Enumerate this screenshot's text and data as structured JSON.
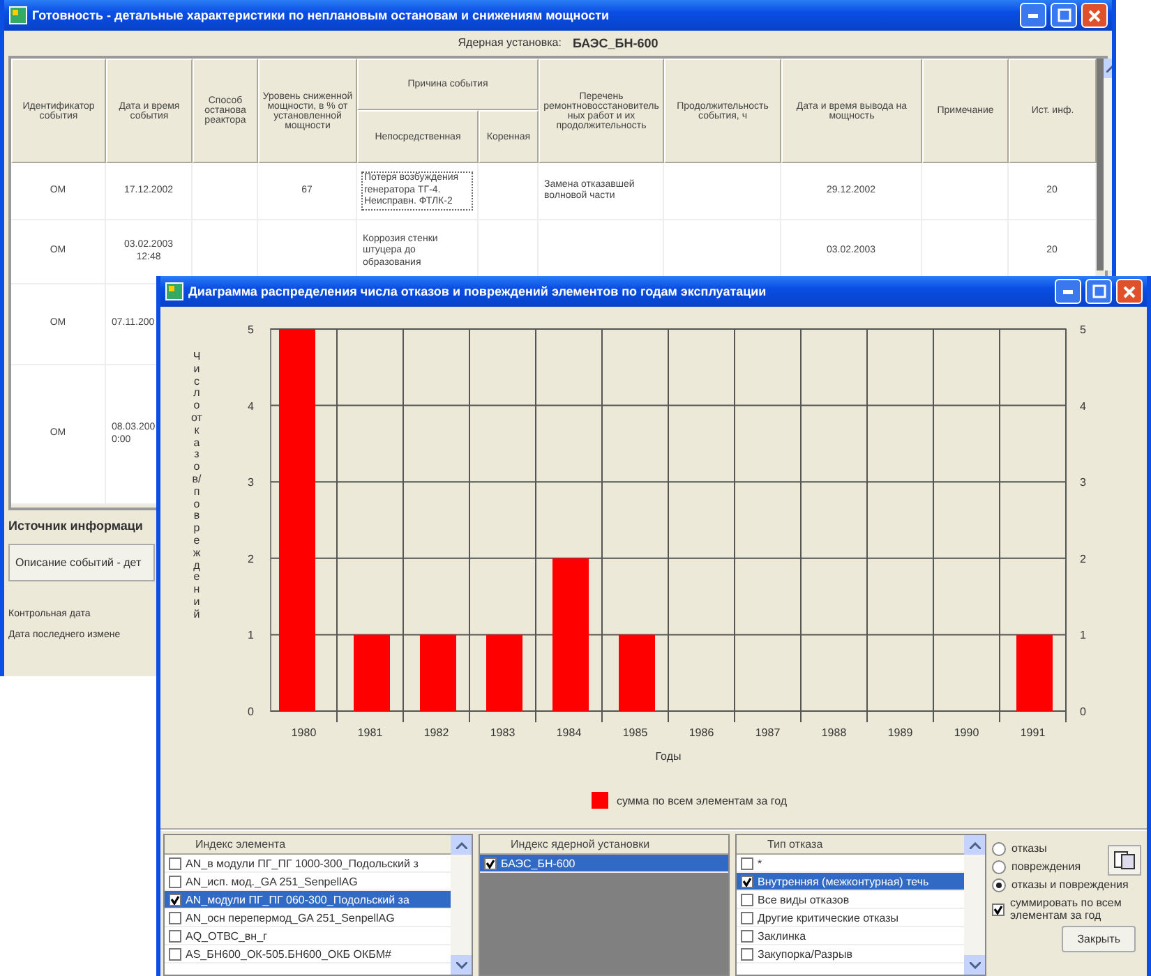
{
  "main_window": {
    "title": "Готовность - детальные характеристики по неплановым остановам и снижениям мощности",
    "plant_label": "Ядерная установка:",
    "plant_value": "БАЭС_БН-600",
    "columns": [
      {
        "label": "Идентификатор события"
      },
      {
        "label": "Дата и время события"
      },
      {
        "label": "Способ останова реактора"
      },
      {
        "label": "Уровень сниженной мощности, в % от установленной мощности"
      },
      {
        "label": "Причина события",
        "children": [
          {
            "label": "Непосредственная"
          },
          {
            "label": "Коренная"
          }
        ]
      },
      {
        "label": "Перечень ремонтновосстановительных работ и их продолжительность"
      },
      {
        "label": "Продолжительность события, ч"
      },
      {
        "label": "Дата и время вывода на мощность"
      },
      {
        "label": "Примечание"
      },
      {
        "label": "Ист. инф."
      }
    ],
    "rows": [
      {
        "id": "ОМ",
        "date": "17.12.2002",
        "power_level": "67",
        "cause_direct": "Потеря возбуждения генератора ТГ-4. Неисправн. ФТЛК-2",
        "repairs": "Замена отказавшей волновой части",
        "return_date": "29.12.2002",
        "source": "20"
      },
      {
        "id": "ОМ",
        "date": "03.02.2003 12:48",
        "cause_direct": "Коррозия стенки штуцера до образования",
        "return_date": "03.02.2003",
        "source": "20"
      },
      {
        "id": "ОМ",
        "date": "07.11.200"
      },
      {
        "id": "ОМ",
        "date": "08.03.200 0:00"
      }
    ],
    "source_heading": "Источник информаци",
    "description_button": "Описание событий - дет",
    "control_date_label": "Контрольная дата",
    "last_change_label": "Дата последнего измене"
  },
  "chart_window": {
    "title": "Диаграмма распределения числа отказов и повреждений элементов по годам эксплуатации",
    "chart_data": {
      "type": "bar",
      "xlabel": "Годы",
      "ylabel": "Число отказов/повреждений",
      "categories": [
        "1980",
        "1981",
        "1982",
        "1983",
        "1984",
        "1985",
        "1986",
        "1987",
        "1988",
        "1989",
        "1990",
        "1991"
      ],
      "series": [
        {
          "name": "сумма по всем элементам за год",
          "color": "#ff0000",
          "values": [
            5,
            1,
            1,
            1,
            2,
            1,
            0,
            0,
            0,
            0,
            0,
            1
          ]
        }
      ],
      "ylim": [
        0,
        5
      ],
      "yticks": [
        {
          "value": 0,
          "label": "0"
        },
        {
          "value": 1,
          "label": "1"
        },
        {
          "value": 2,
          "label": "2"
        },
        {
          "value": 3,
          "label": "3"
        },
        {
          "value": 4,
          "label": "4"
        },
        {
          "value": 5,
          "label": "5"
        }
      ],
      "grid": true
    },
    "right_axis_ticks": [
      "5",
      "4",
      "3",
      "2",
      "1",
      "0"
    ],
    "element_list": {
      "header": "Индекс элемента",
      "items": [
        {
          "label": "AN_в модули ПГ_ПГ 1000-300_Подольский з",
          "checked": false,
          "selected": false
        },
        {
          "label": "AN_исп. мод._GA 251_SenpellAG",
          "checked": false,
          "selected": false
        },
        {
          "label": "AN_модули ПГ_ПГ 060-300_Подольский за",
          "checked": true,
          "selected": true
        },
        {
          "label": "AN_осн перепермод_GA 251_SenpellAG",
          "checked": false,
          "selected": false
        },
        {
          "label": "AQ_ОТВС_вн_г",
          "checked": false,
          "selected": false
        },
        {
          "label": "AS_БН600_ОК-505.БН600_ОКБ ОКБМ#",
          "checked": false,
          "selected": false
        }
      ]
    },
    "plant_list": {
      "header": "Индекс ядерной установки",
      "items": [
        {
          "label": "БАЭС_БН-600",
          "checked": true,
          "selected": true
        }
      ]
    },
    "failure_list": {
      "header": "Тип отказа",
      "items": [
        {
          "label": "*",
          "checked": false,
          "selected": false
        },
        {
          "label": "Внутренняя (межконтурная) течь",
          "checked": true,
          "selected": true
        },
        {
          "label": "Все виды отказов",
          "checked": false,
          "selected": false
        },
        {
          "label": "Другие критические отказы",
          "checked": false,
          "selected": false
        },
        {
          "label": "Заклинка",
          "checked": false,
          "selected": false
        },
        {
          "label": "Закупорка/Разрыв",
          "checked": false,
          "selected": false
        }
      ]
    },
    "mode_options": [
      {
        "label": "отказы",
        "selected": false
      },
      {
        "label": "повреждения",
        "selected": false
      },
      {
        "label": "отказы и повреждения",
        "selected": true
      }
    ],
    "sum_checkbox": {
      "label": "суммировать по всем элементам за год",
      "checked": true
    },
    "close_button": "Закрыть"
  }
}
